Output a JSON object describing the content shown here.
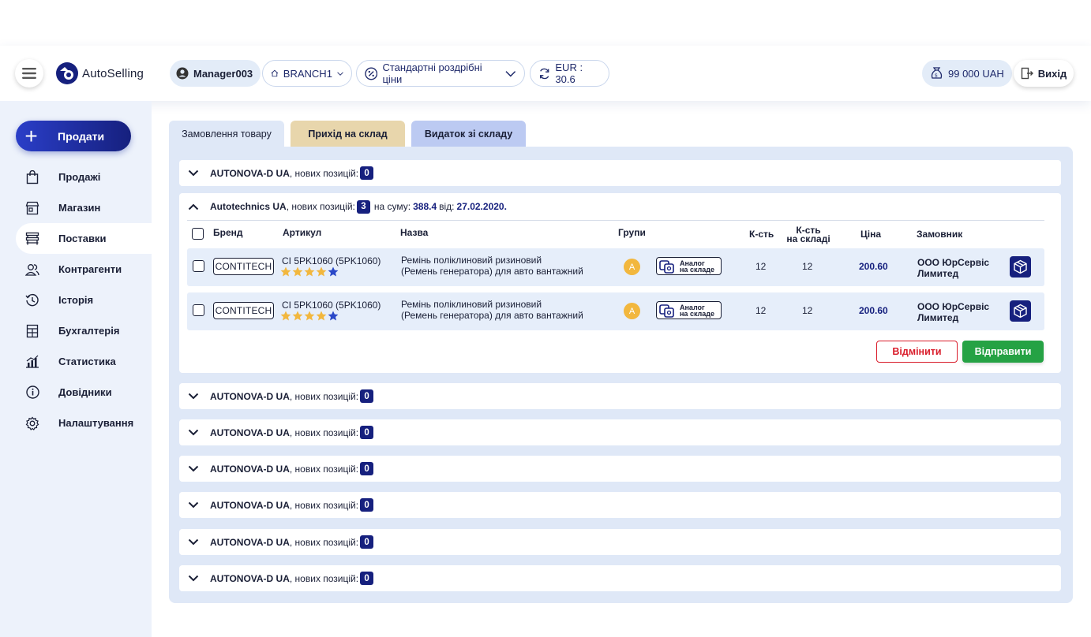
{
  "app": {
    "name": "AutoSelling"
  },
  "header": {
    "user": "Manager003",
    "branch": "BRANCH1",
    "price_type": "Стандартні роздрібні ціни",
    "currency_label": "EUR",
    "currency_rate": " : 30.6",
    "balance": "99 000 UAH",
    "exit_label": "Вихід"
  },
  "sidebar": {
    "sell_label": "Продати",
    "items": [
      {
        "label": "Продажі",
        "icon": "bag-icon"
      },
      {
        "label": "Магазин",
        "icon": "store-icon"
      },
      {
        "label": "Поставки",
        "icon": "pallet-icon",
        "active": true
      },
      {
        "label": "Контрагенти",
        "icon": "users-icon"
      },
      {
        "label": "Історія",
        "icon": "history-icon"
      },
      {
        "label": "Бухгалтерія",
        "icon": "accounting-icon"
      },
      {
        "label": "Статистика",
        "icon": "stats-icon"
      },
      {
        "label": "Довідники",
        "icon": "info-icon"
      },
      {
        "label": "Налаштування",
        "icon": "gear-icon"
      }
    ]
  },
  "tabs": [
    "Замовлення товару",
    "Прихід на склад",
    "Видаток зі складу"
  ],
  "order_groups": {
    "new_positions_text": ", нових позицій:",
    "collapsed_supplier": "AUTONOVA-D UA",
    "collapsed_count": "0",
    "expanded": {
      "supplier": "Autotechnics UA",
      "count": "3",
      "sum_label": "на суму:",
      "sum_value": "388.4",
      "date_label": "від:",
      "date_value": "27.02.2020."
    }
  },
  "table": {
    "headers": {
      "brand": "Бренд",
      "article": "Артикул",
      "name": "Назва",
      "groups": "Групи",
      "qty": "К-сть",
      "stock_qty_1": "К-сть",
      "stock_qty_2": "на складі",
      "price": "Ціна",
      "customer": "Замовник"
    },
    "rows": [
      {
        "brand": "CONTITECH",
        "article": "CI 5PK1060 (5PK1060)",
        "rating": 4,
        "name_line1": "Ремінь поліклиновий ризиновий",
        "name_line2": "(Ремень генератора) для авто вантажний",
        "group": "A",
        "analog_line1": "Аналог",
        "analog_line2": "на складе",
        "qty": "12",
        "stock": "12",
        "price": "200.60",
        "customer_line1": "ООО ЮрСервіс",
        "customer_line2": "Лимитед"
      },
      {
        "brand": "CONTITECH",
        "article": "CI 5PK1060 (5PK1060)",
        "rating": 4,
        "name_line1": "Ремінь поліклиновий ризиновий",
        "name_line2": "(Ремень генератора) для авто вантажний",
        "group": "A",
        "analog_line1": "Аналог",
        "analog_line2": "на складе",
        "qty": "12",
        "stock": "12",
        "price": "200.60",
        "customer_line1": "ООО ЮрСервіс",
        "customer_line2": "Лимитед"
      }
    ]
  },
  "actions": {
    "cancel": "Відмінити",
    "send": "Відправити"
  },
  "colors": {
    "brand": "#16207e",
    "accent_green": "#25a244",
    "accent_red": "#d91c2a",
    "star": "#f2b73e"
  }
}
